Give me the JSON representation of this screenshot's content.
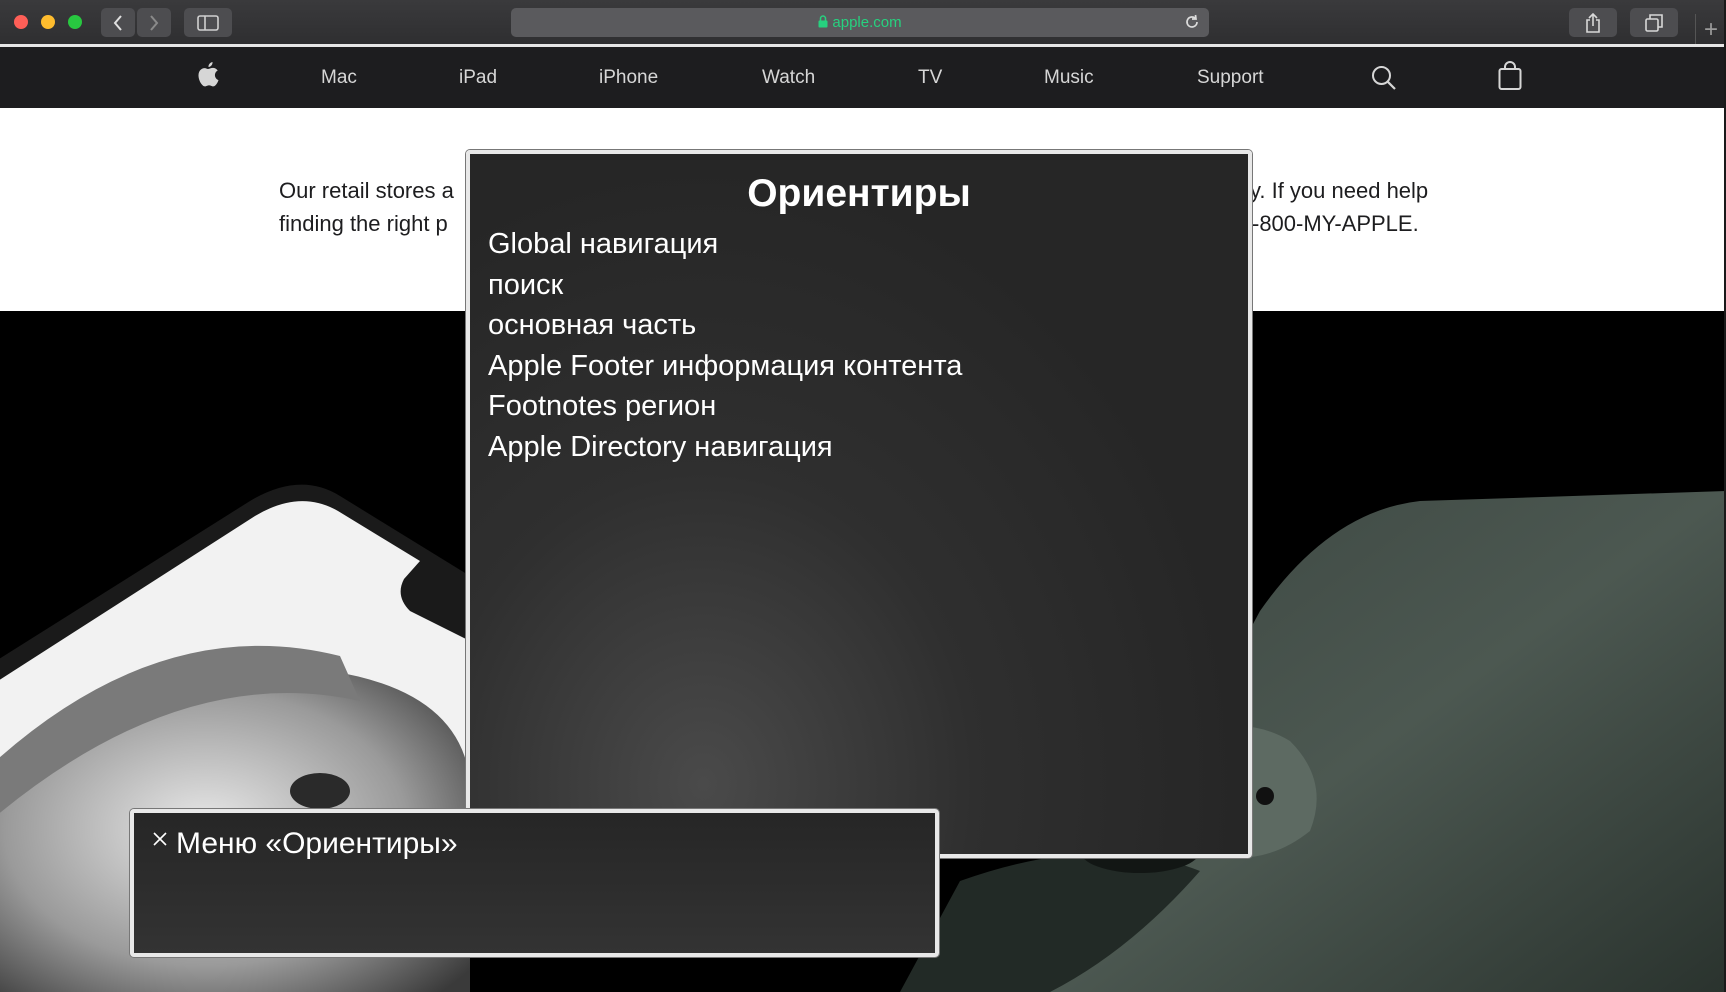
{
  "browser": {
    "url": "apple.com",
    "new_tab_glyph": "+"
  },
  "nav": {
    "items": [
      "Mac",
      "iPad",
      "iPhone",
      "Watch",
      "TV",
      "Music",
      "Support"
    ],
    "icons": [
      "apple-logo-icon",
      "search-icon",
      "bag-icon"
    ]
  },
  "page": {
    "notice_line1": "Our retail stores a",
    "notice_line1_end": "y. If you need help",
    "notice_line2": "finding the right p",
    "notice_line2_end": "-800-MY-APPLE."
  },
  "rotor": {
    "title": "Ориентиры",
    "items": [
      "Global навигация",
      "поиск",
      "основная часть",
      "Apple Footer информация контента",
      "Footnotes регион",
      "Apple Directory навигация"
    ]
  },
  "caption": {
    "text": "Меню «Ориентиры»"
  }
}
